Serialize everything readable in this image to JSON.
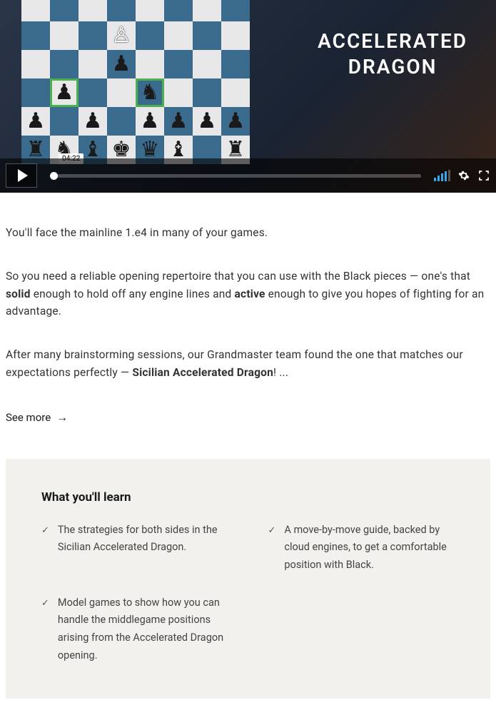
{
  "video": {
    "title_line1": "ACCELERATED",
    "title_line2": "DRAGON",
    "timestamp": "04:22"
  },
  "paragraphs": {
    "p1": "You'll face the mainline 1.e4 in many of your games.",
    "p2_pre": "So you need a reliable opening repertoire that you can use with the Black pieces — one's that ",
    "p2_bold1": "solid",
    "p2_mid": " enough to hold off any engine lines and ",
    "p2_bold2": "active",
    "p2_post": " enough to give you hopes of fighting for an advantage.",
    "p3_pre": "After many brainstorming sessions, our Grandmaster team found the one that matches our expectations perfectly — ",
    "p3_bold": "Sicilian Accelerated Dragon",
    "p3_post": "! ..."
  },
  "see_more": "See more",
  "learn": {
    "heading": "What you'll learn",
    "items": [
      "The strategies for both sides in the Sicilian Accelerated Dragon.",
      "A move-by-move guide, backed by cloud engines, to get a comfortable position with Black.",
      "Model games to show how you can handle the middlegame positions arising from the Accelerated Dragon opening."
    ]
  }
}
